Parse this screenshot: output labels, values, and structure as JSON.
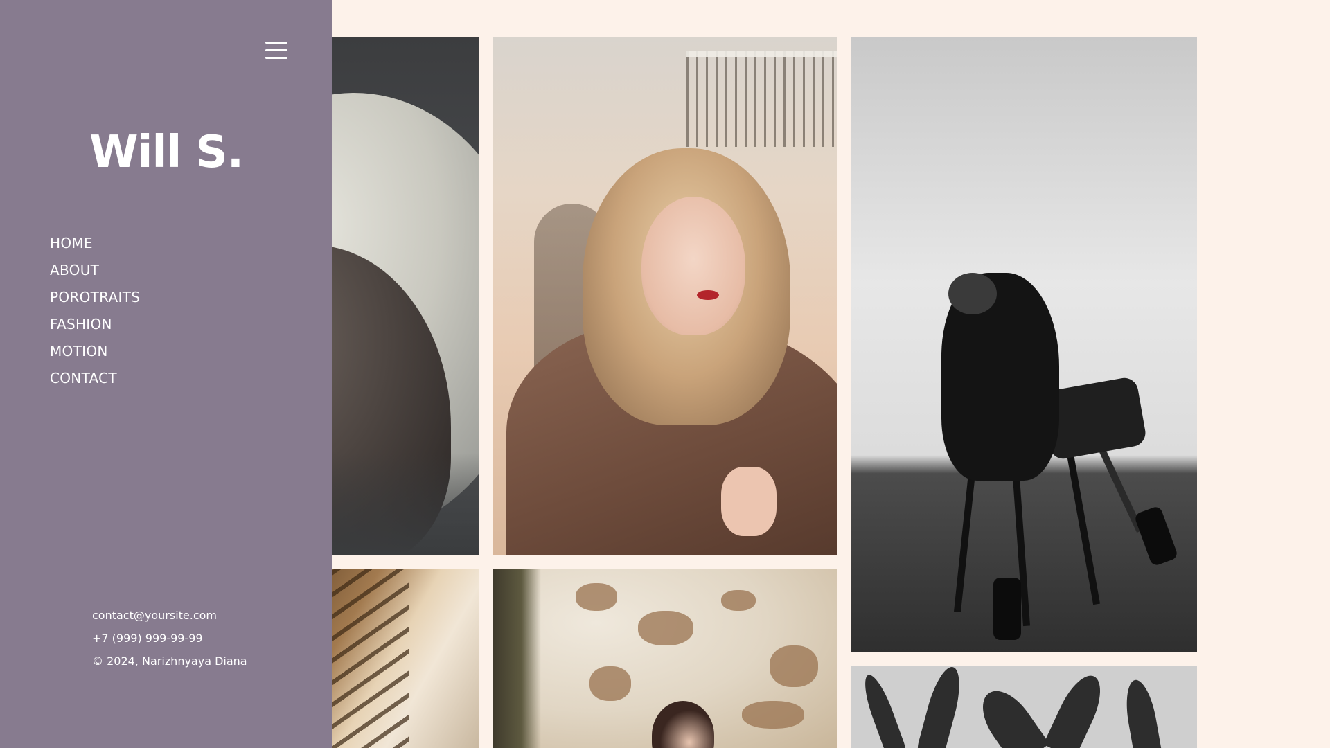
{
  "sidebar": {
    "logo": "Will S.",
    "nav": {
      "items": [
        {
          "label": "HOME"
        },
        {
          "label": "ABOUT"
        },
        {
          "label": "POROTRAITS"
        },
        {
          "label": "FASHION"
        },
        {
          "label": "MOTION"
        },
        {
          "label": "CONTACT"
        }
      ]
    },
    "contact": {
      "email": "contact@yoursite.com",
      "phone": "+7 (999) 999-99-99",
      "copyright": "© 2024, Narizhnyaya Diana"
    }
  },
  "icons": {
    "menu": "hamburger-menu-icon"
  },
  "colors": {
    "sidebar_bg": "#877b8f",
    "page_bg": "#fdf2ea",
    "text": "#ffffff"
  }
}
